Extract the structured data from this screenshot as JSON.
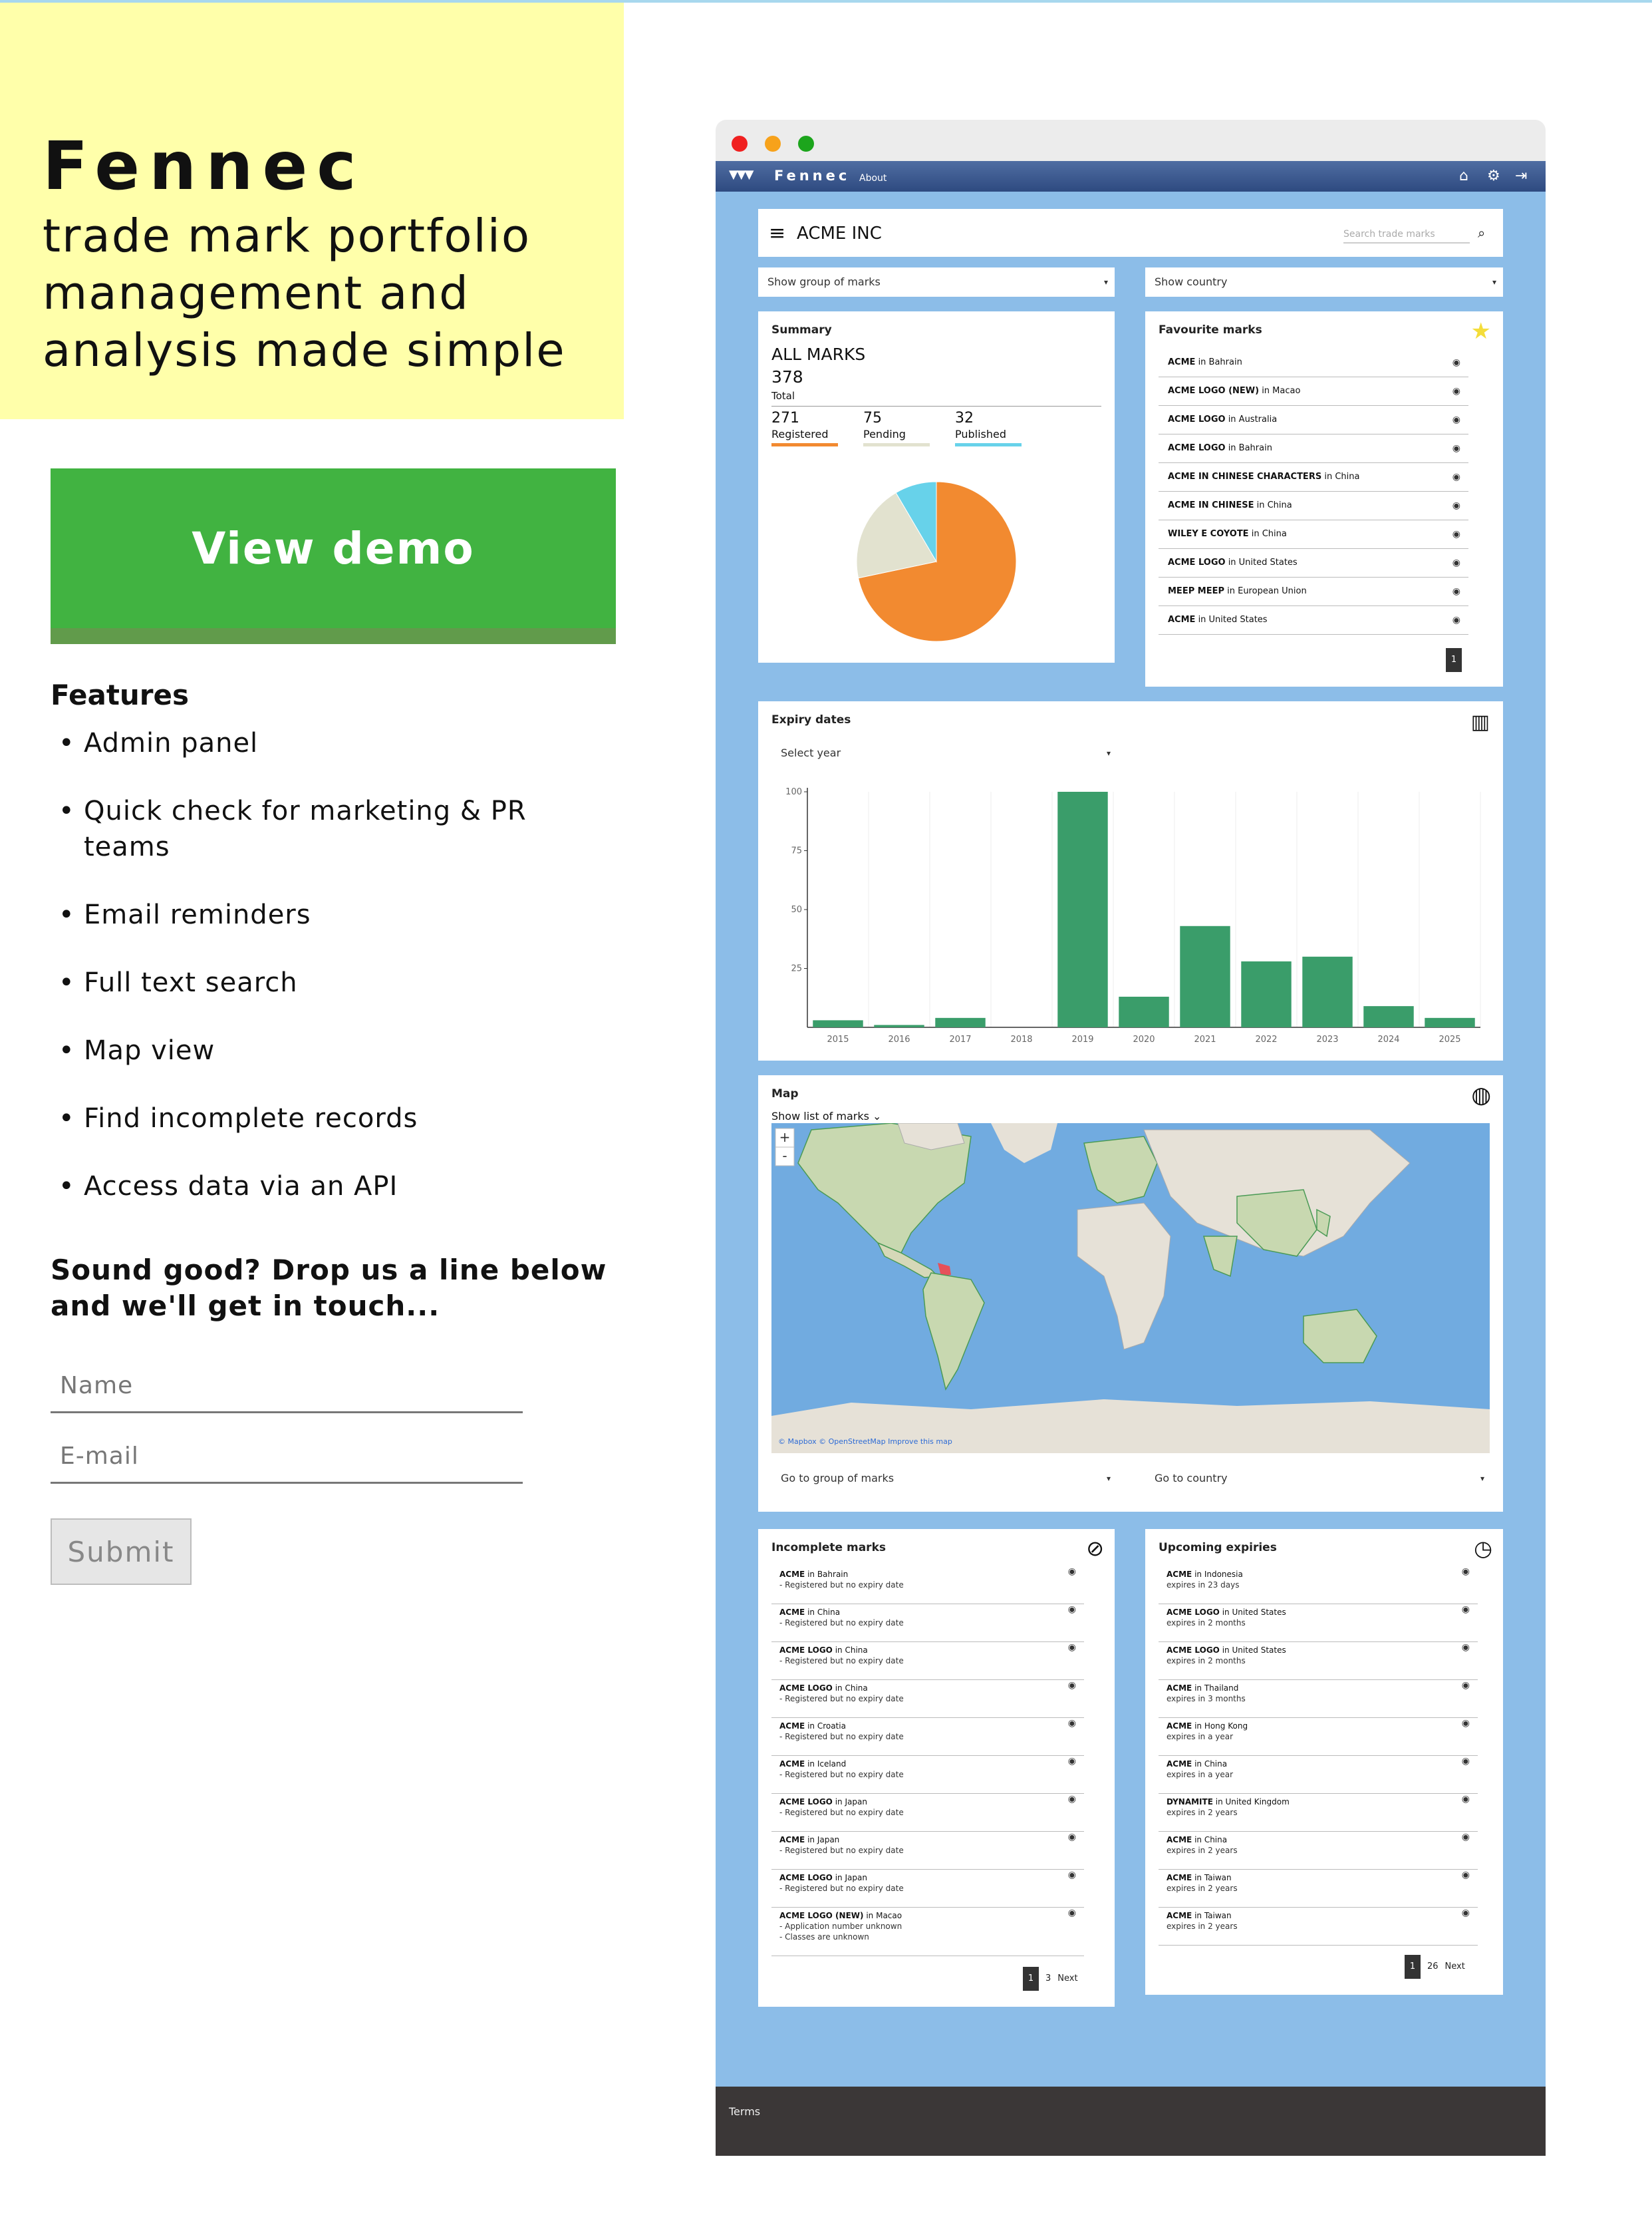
{
  "brand": "Fennec",
  "tagline": "trade mark portfolio management and analysis made simple",
  "demo_button": "View demo",
  "features_title": "Features",
  "features": [
    "Admin panel",
    "Quick check for marketing & PR teams",
    "Email reminders",
    "Full text search",
    "Map view",
    "Find incomplete records",
    "Access data via an API"
  ],
  "cta": "Sound good? Drop us a line below and we'll get in touch...",
  "form": {
    "name_placeholder": "Name",
    "email_placeholder": "E-mail",
    "submit_label": "Submit"
  },
  "app": {
    "logo_text": "Fennec",
    "nav_about": "About",
    "org_name": "ACME INC",
    "search_placeholder": "Search trade marks",
    "group_select": "Show group of marks",
    "country_select": "Show country",
    "summary": {
      "title": "Summary",
      "label": "ALL MARKS",
      "total": "378",
      "total_label": "Total",
      "registered": "271",
      "registered_label": "Registered",
      "pending": "75",
      "pending_label": "Pending",
      "published": "32",
      "published_label": "Published",
      "colors": {
        "registered": "#f28a30",
        "pending": "#e2e2cf",
        "published": "#67d2ea"
      }
    },
    "favourites": {
      "title": "Favourite marks",
      "items": [
        {
          "mark": "ACME",
          "country": "in Bahrain"
        },
        {
          "mark": "ACME LOGO (NEW)",
          "country": "in Macao"
        },
        {
          "mark": "ACME LOGO",
          "country": "in Australia"
        },
        {
          "mark": "ACME LOGO",
          "country": "in Bahrain"
        },
        {
          "mark": "ACME IN CHINESE CHARACTERS",
          "country": "in China"
        },
        {
          "mark": "ACME IN CHINESE",
          "country": "in China"
        },
        {
          "mark": "WILEY E COYOTE",
          "country": "in China"
        },
        {
          "mark": "ACME LOGO",
          "country": "in United States"
        },
        {
          "mark": "MEEP MEEP",
          "country": "in European Union"
        },
        {
          "mark": "ACME",
          "country": "in United States"
        }
      ],
      "page": "1"
    },
    "expiry": {
      "title": "Expiry dates",
      "select_year": "Select year"
    },
    "map": {
      "title": "Map",
      "show_list": "Show list of marks",
      "zoom_in": "+",
      "zoom_out": "-",
      "attribution": "© Mapbox © OpenStreetMap Improve this map",
      "group_select": "Go to group of marks",
      "country_select": "Go to country"
    },
    "incomplete": {
      "title": "Incomplete marks",
      "items": [
        {
          "mark": "ACME",
          "country": "in Bahrain",
          "notes": [
            "- Registered but no expiry date"
          ]
        },
        {
          "mark": "ACME",
          "country": "in China",
          "notes": [
            "- Registered but no expiry date"
          ]
        },
        {
          "mark": "ACME LOGO",
          "country": "in China",
          "notes": [
            "- Registered but no expiry date"
          ]
        },
        {
          "mark": "ACME LOGO",
          "country": "in China",
          "notes": [
            "- Registered but no expiry date"
          ]
        },
        {
          "mark": "ACME",
          "country": "in Croatia",
          "notes": [
            "- Registered but no expiry date"
          ]
        },
        {
          "mark": "ACME",
          "country": "in Iceland",
          "notes": [
            "- Registered but no expiry date"
          ]
        },
        {
          "mark": "ACME LOGO",
          "country": "in Japan",
          "notes": [
            "- Registered but no expiry date"
          ]
        },
        {
          "mark": "ACME",
          "country": "in Japan",
          "notes": [
            "- Registered but no expiry date"
          ]
        },
        {
          "mark": "ACME LOGO",
          "country": "in Japan",
          "notes": [
            "- Registered but no expiry date"
          ]
        },
        {
          "mark": "ACME LOGO (NEW)",
          "country": "in Macao",
          "notes": [
            "- Application number unknown",
            "- Classes are unknown"
          ]
        }
      ],
      "page": "1",
      "last_page": "3",
      "next": "Next"
    },
    "upcoming": {
      "title": "Upcoming expiries",
      "items": [
        {
          "mark": "ACME",
          "country": "in Indonesia",
          "note": "expires in 23 days"
        },
        {
          "mark": "ACME LOGO",
          "country": "in United States",
          "note": "expires in 2 months"
        },
        {
          "mark": "ACME LOGO",
          "country": "in United States",
          "note": "expires in 2 months"
        },
        {
          "mark": "ACME",
          "country": "in Thailand",
          "note": "expires in 3 months"
        },
        {
          "mark": "ACME",
          "country": "in Hong Kong",
          "note": "expires in a year"
        },
        {
          "mark": "ACME",
          "country": "in China",
          "note": "expires in a year"
        },
        {
          "mark": "DYNAMITE",
          "country": "in United Kingdom",
          "note": "expires in 2 years"
        },
        {
          "mark": "ACME",
          "country": "in China",
          "note": "expires in 2 years"
        },
        {
          "mark": "ACME",
          "country": "in Taiwan",
          "note": "expires in 2 years"
        },
        {
          "mark": "ACME",
          "country": "in Taiwan",
          "note": "expires in 2 years"
        }
      ],
      "page": "1",
      "last_page": "26",
      "next": "Next"
    },
    "footer_terms": "Terms"
  },
  "chart_data": [
    {
      "type": "pie",
      "categories": [
        "Registered",
        "Pending",
        "Published"
      ],
      "values": [
        271,
        75,
        32
      ]
    },
    {
      "type": "bar",
      "categories": [
        "2015",
        "2016",
        "2017",
        "2018",
        "2019",
        "2020",
        "2021",
        "2022",
        "2023",
        "2024",
        "2025"
      ],
      "values": [
        3,
        1,
        4,
        0,
        100,
        13,
        43,
        28,
        30,
        9,
        4
      ],
      "ylim": [
        0,
        100
      ],
      "yticks": [
        25,
        50,
        75,
        100
      ],
      "color": "#3a9d6a",
      "grid": true
    }
  ]
}
